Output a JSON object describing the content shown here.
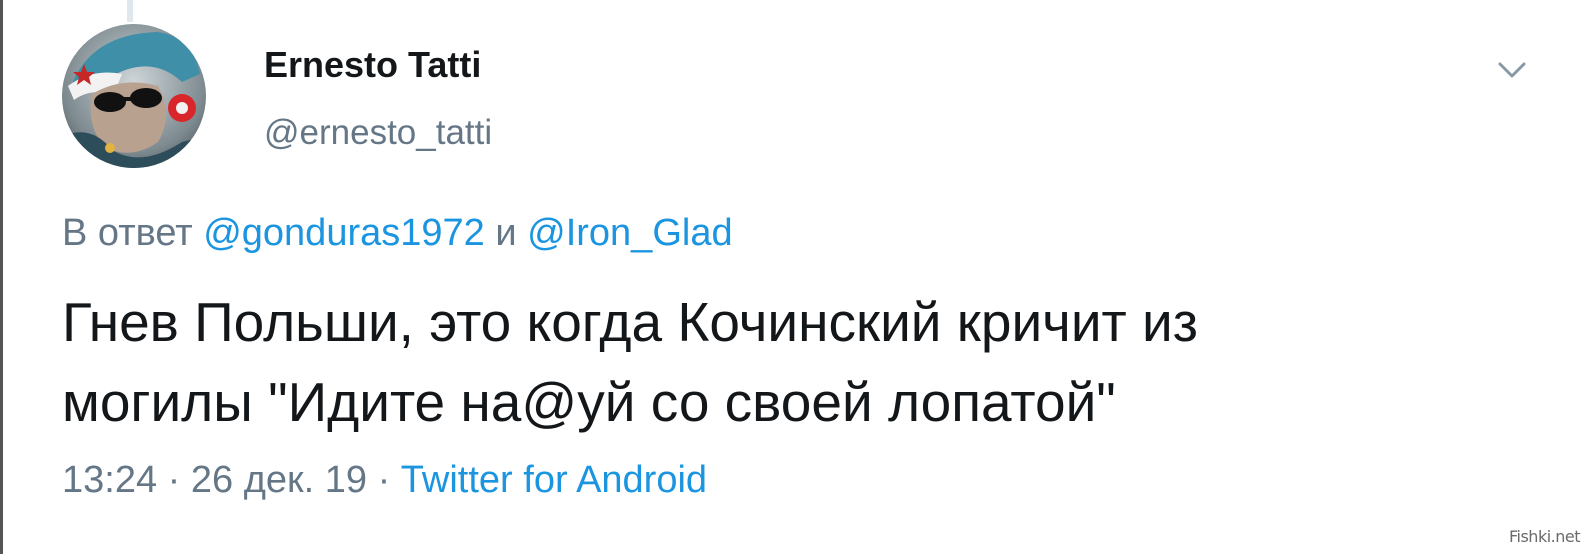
{
  "tweet": {
    "display_name": "Ernesto Tatti",
    "handle": "@ernesto_tatti",
    "reply_prefix": "В ответ ",
    "reply_mention_1": "@gonduras1972",
    "reply_joiner": " и ",
    "reply_mention_2": "@Iron_Glad",
    "text_line_1": "Гнев Польши, это когда Кочинский кричит из",
    "text_line_2": "могилы \"Идите на@уй со своей лопатой\"",
    "time": "13:24",
    "separator_1": " · ",
    "date": "26 дек. 19",
    "separator_2": " · ",
    "source": "Twitter for Android"
  },
  "icons": {
    "menu": "chevron-down-icon",
    "avatar": "avatar-image"
  },
  "watermark": "Fishki.net",
  "colors": {
    "text_primary": "#14171a",
    "text_secondary": "#657786",
    "link": "#1b95e0",
    "background": "#ffffff"
  }
}
